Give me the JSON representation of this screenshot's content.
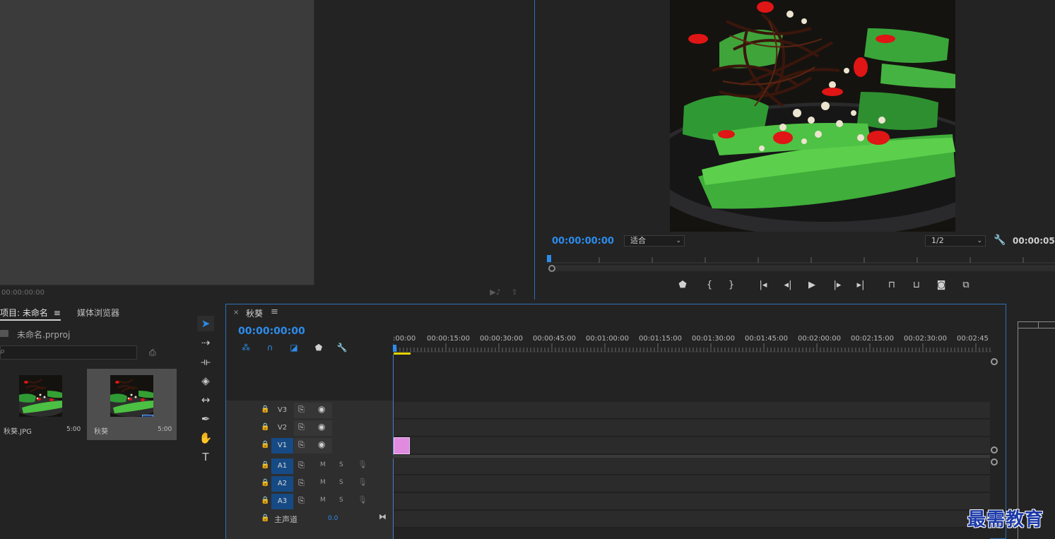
{
  "source_monitor": {
    "timecode": "00:00:00:00"
  },
  "program_monitor": {
    "timecode": "00:00:00:00",
    "zoom_select": "适合",
    "resolution_select": "1/2",
    "duration": "00:00:05:",
    "transport_icons": [
      "marker-icon",
      "mark-in-icon",
      "mark-out-icon",
      "go-to-in-icon",
      "step-back-icon",
      "play-icon",
      "step-forward-icon",
      "go-to-out-icon",
      "lift-icon",
      "extract-icon",
      "export-frame-icon",
      "comparison-view-icon"
    ]
  },
  "project": {
    "tab_project": "项目: 未命名",
    "tab_media_browser": "媒体浏览器",
    "filename": "未命名.prproj",
    "search_placeholder": "",
    "items": [
      {
        "name": "秋葵.JPG",
        "duration": "5:00"
      },
      {
        "name": "秋葵",
        "duration": "5:00"
      }
    ]
  },
  "tools": [
    "selection-tool-icon",
    "track-select-forward-icon",
    "ripple-edit-icon",
    "razor-icon",
    "slip-icon",
    "pen-icon",
    "hand-icon",
    "type-icon"
  ],
  "timeline": {
    "sequence_name": "秋葵",
    "timecode": "00:00:00:00",
    "ruler_labels": [
      ":00:00",
      "00:00:15:00",
      "00:00:30:00",
      "00:00:45:00",
      "00:01:00:00",
      "00:01:15:00",
      "00:01:30:00",
      "00:01:45:00",
      "00:02:00:00",
      "00:02:15:00",
      "00:02:30:00",
      "00:02:45:0"
    ],
    "video_tracks": [
      {
        "name": "V3",
        "active": false
      },
      {
        "name": "V2",
        "active": false
      },
      {
        "name": "V1",
        "active": true
      }
    ],
    "audio_tracks": [
      {
        "name": "A1",
        "m": "M",
        "s": "S"
      },
      {
        "name": "A2",
        "m": "M",
        "s": "S"
      },
      {
        "name": "A3",
        "m": "M",
        "s": "S"
      }
    ],
    "master": {
      "label": "主声道",
      "value": "0.0"
    },
    "clip_color": "#e08ae0"
  },
  "watermark": "最需教育"
}
